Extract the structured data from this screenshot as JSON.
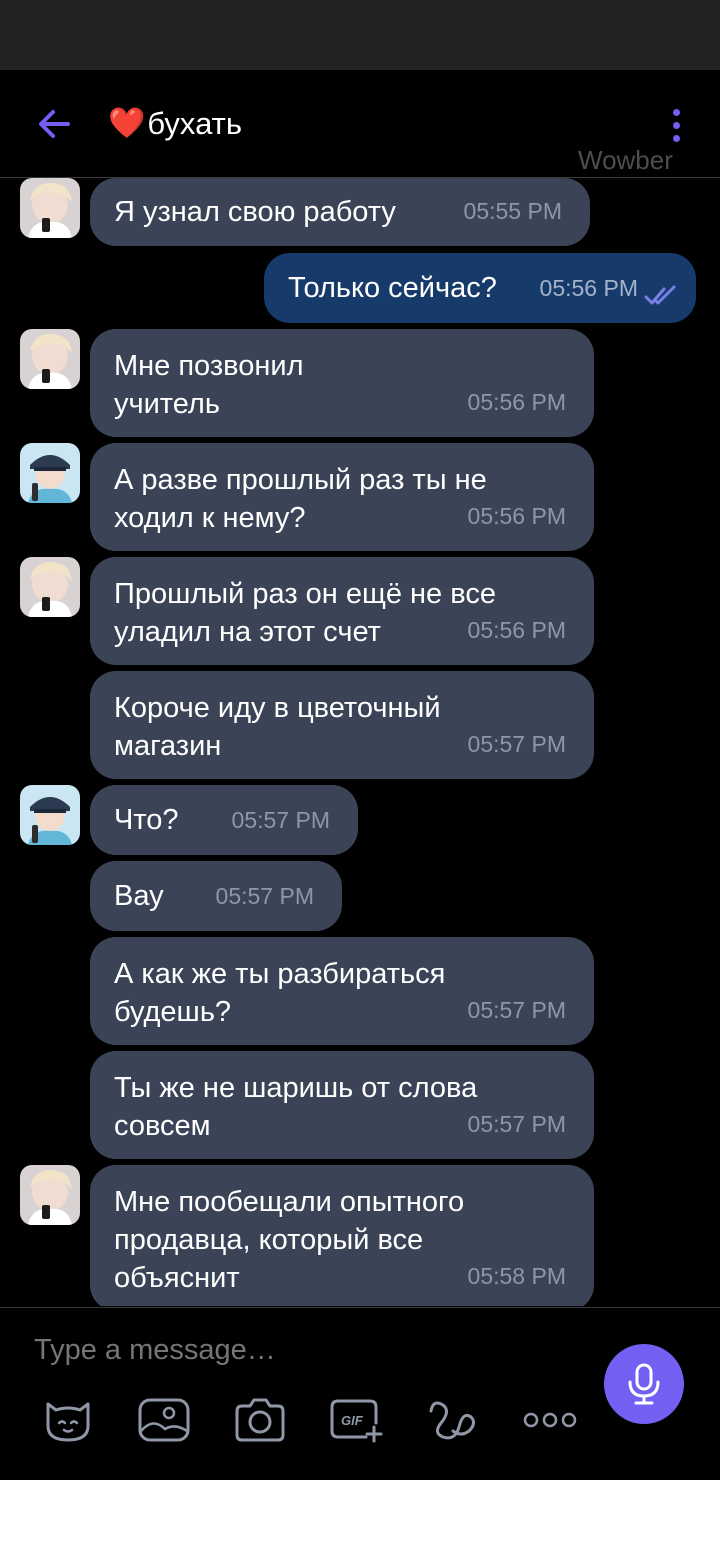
{
  "header": {
    "title_heart": "❤️",
    "title": "бухать",
    "watermark": "Wowber",
    "back_icon": "arrow-left-icon",
    "menu_icon": "more-vertical-icon"
  },
  "messages": [
    {
      "text": "Я узнал свою работу",
      "time": "05:55 PM",
      "direction": "in",
      "avatar": "avatar-blonde"
    },
    {
      "text": "Только сейчас?",
      "time": "05:56 PM",
      "direction": "out",
      "status": "read"
    },
    {
      "text": "Мне позвонил\nучитель",
      "time": "05:56 PM",
      "direction": "in",
      "avatar": "avatar-blonde"
    },
    {
      "text": "А разве прошлый раз ты не\nходил к нему?",
      "time": "05:56 PM",
      "direction": "in",
      "avatar": "avatar-cap"
    },
    {
      "text": "Прошлый раз он ещё не все\nуладил на этот счет",
      "time": "05:56 PM",
      "direction": "in",
      "avatar": "avatar-blonde"
    },
    {
      "text": "Короче иду в цветочный\nмагазин",
      "time": "05:57 PM",
      "direction": "in"
    },
    {
      "text": "Что?",
      "time": "05:57 PM",
      "direction": "in",
      "avatar": "avatar-cap"
    },
    {
      "text": "Вау",
      "time": "05:57 PM",
      "direction": "in"
    },
    {
      "text": "А как же ты разбираться\nбудешь?",
      "time": "05:57 PM",
      "direction": "in"
    },
    {
      "text": "Ты же не шаришь от слова\nсовсем",
      "time": "05:57 PM",
      "direction": "in"
    },
    {
      "text": "Мне пообещали опытного\nпродавца, который все\nобъяснит",
      "time": "05:58 PM",
      "direction": "in",
      "avatar": "avatar-blonde"
    }
  ],
  "composer": {
    "placeholder": "Type a message…",
    "mic_icon": "microphone-icon",
    "tools": [
      "sticker-icon",
      "gallery-icon",
      "camera-icon",
      "gif-icon",
      "doodle-icon",
      "more-horizontal-icon"
    ]
  },
  "colors": {
    "accent": "#7360f2",
    "incoming_bubble": "#3b4457",
    "outgoing_bubble": "#163b6b",
    "background": "#000000"
  }
}
